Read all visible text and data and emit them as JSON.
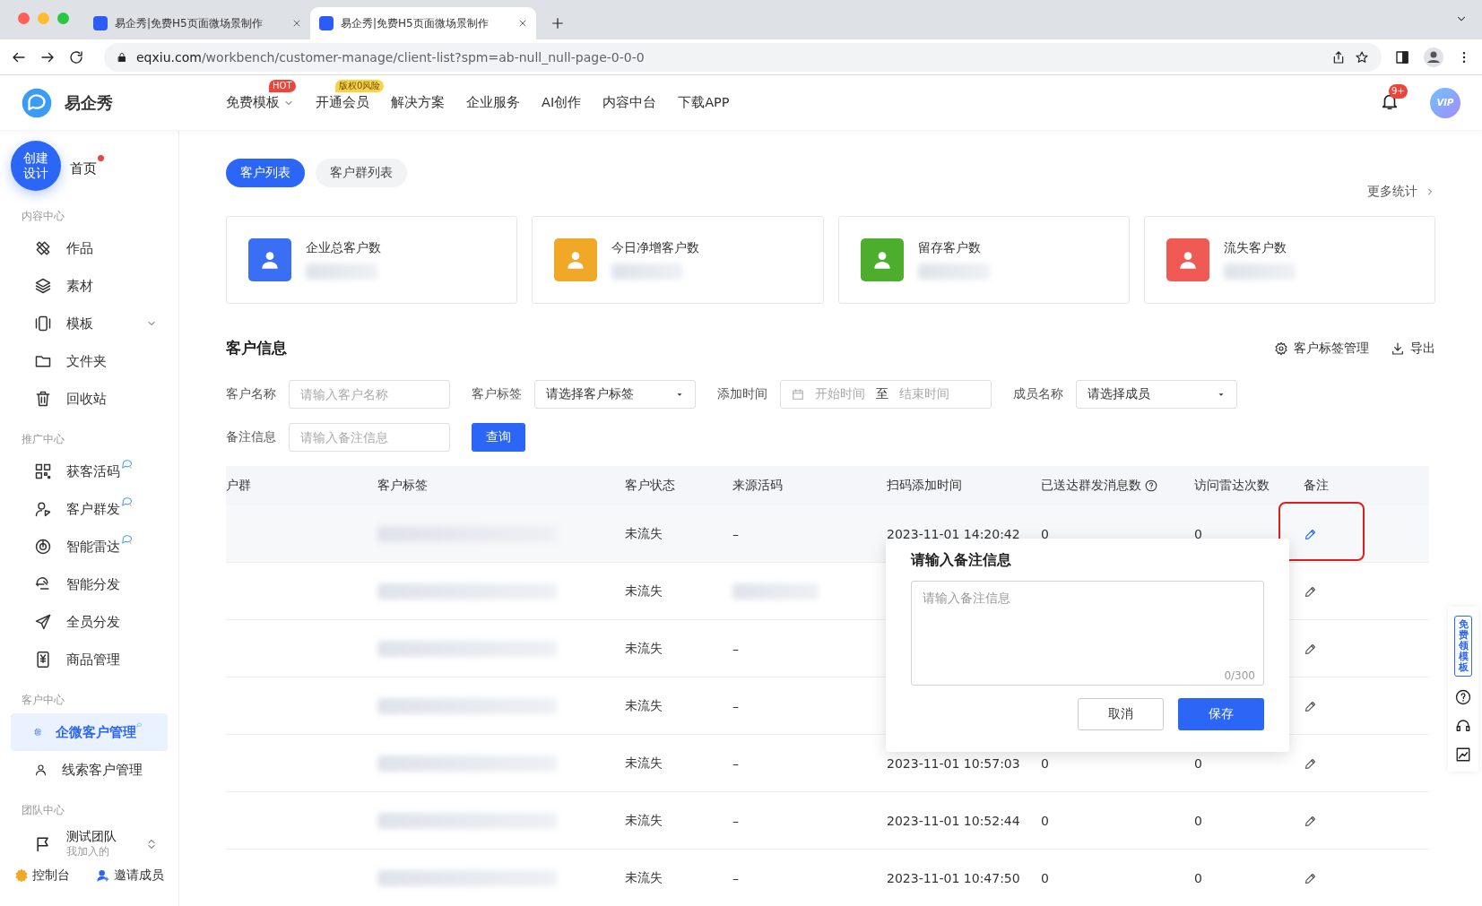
{
  "browser": {
    "tabs": [
      {
        "title": "易企秀|免费H5页面微场景制作",
        "selected": false
      },
      {
        "title": "易企秀|免费H5页面微场景制作",
        "selected": true
      }
    ],
    "url_host": "eqxiu.com",
    "url_path": "/workbench/customer-manage/client-list?spm=ab-null_null-page-0-0-0"
  },
  "header": {
    "logo_text": "易企秀",
    "nav": [
      {
        "label": "免费模板",
        "badge": "HOT",
        "caret": true
      },
      {
        "label": "开通会员",
        "badge": "版权0风险",
        "caret": false
      },
      {
        "label": "解决方案",
        "caret": false
      },
      {
        "label": "企业服务",
        "caret": false
      },
      {
        "label": "AI创作",
        "caret": false
      },
      {
        "label": "内容中台",
        "caret": false
      },
      {
        "label": "下载APP",
        "caret": false
      }
    ],
    "notifications": "9+",
    "vip": "VIP"
  },
  "sidebar": {
    "create_button": [
      "创建",
      "设计"
    ],
    "home": {
      "label": "首页",
      "dot": true
    },
    "sections": [
      {
        "title": "内容中心",
        "items": [
          {
            "label": "作品",
            "selected": false,
            "new": false,
            "expandable": false
          },
          {
            "label": "素材",
            "selected": false,
            "new": false,
            "expandable": false
          },
          {
            "label": "模板",
            "selected": false,
            "new": false,
            "expandable": true
          },
          {
            "label": "文件夹",
            "selected": false,
            "new": false,
            "expandable": false
          },
          {
            "label": "回收站",
            "selected": false,
            "new": false,
            "expandable": false
          }
        ]
      },
      {
        "title": "推广中心",
        "items": [
          {
            "label": "获客活码",
            "selected": false,
            "new": true,
            "expandable": false
          },
          {
            "label": "客户群发",
            "selected": false,
            "new": true,
            "expandable": false
          },
          {
            "label": "智能雷达",
            "selected": false,
            "new": true,
            "expandable": false
          },
          {
            "label": "智能分发",
            "selected": false,
            "new": false,
            "expandable": false
          },
          {
            "label": "全员分发",
            "selected": false,
            "new": false,
            "expandable": false
          },
          {
            "label": "商品管理",
            "selected": false,
            "new": false,
            "expandable": false
          }
        ]
      },
      {
        "title": "客户中心",
        "items": [
          {
            "label": "企微客户管理",
            "selected": true,
            "new": true,
            "expandable": false
          },
          {
            "label": "线索客户管理",
            "selected": false,
            "new": false,
            "expandable": false
          }
        ]
      },
      {
        "title": "团队中心"
      }
    ],
    "team": {
      "name": "测试团队",
      "sub": "我加入的"
    },
    "footer": [
      "控制台",
      "邀请成员"
    ]
  },
  "content": {
    "tabs": [
      {
        "label": "客户列表",
        "selected": true
      },
      {
        "label": "客户群列表",
        "selected": false
      }
    ],
    "more_stats": "更多统计",
    "stat_cards": [
      {
        "label": "企业总客户数",
        "color": "#3a6ff5"
      },
      {
        "label": "今日净增客户数",
        "color": "#f0a826"
      },
      {
        "label": "留存客户数",
        "color": "#4cae2c"
      },
      {
        "label": "流失客户数",
        "color": "#f05a55"
      }
    ],
    "section_title": "客户信息",
    "actions": [
      "客户标签管理",
      "导出"
    ],
    "filters": [
      {
        "kind": "input",
        "label": "客户名称",
        "placeholder": "请输入客户名称"
      },
      {
        "kind": "select",
        "label": "客户标签",
        "value": "请选择客户标签"
      },
      {
        "kind": "daterange",
        "label": "添加时间",
        "start": "开始时间",
        "to": "至",
        "end": "结束时间"
      },
      {
        "kind": "select",
        "label": "成员名称",
        "value": "请选择成员"
      },
      {
        "kind": "input",
        "label": "备注信息",
        "placeholder": "请输入备注信息"
      }
    ],
    "query_button": "查询",
    "table": {
      "columns": [
        {
          "label": "户群",
          "help": false
        },
        {
          "label": "客户标签",
          "help": false
        },
        {
          "label": "客户状态",
          "help": false
        },
        {
          "label": "来源活码",
          "help": false
        },
        {
          "label": "扫码添加时间",
          "help": false
        },
        {
          "label": "已送达群发消息数",
          "help": true
        },
        {
          "label": "访问雷达次数",
          "help": false
        },
        {
          "label": "备注",
          "help": false
        }
      ],
      "rows": [
        {
          "selected": true,
          "tag_blurred": true,
          "status": "未流失",
          "source": "–",
          "time": "2023-11-01 14:20:42",
          "sent": "0",
          "visits": "0"
        },
        {
          "selected": false,
          "tag_blurred": true,
          "status": "未流失",
          "source_blurred": true
        },
        {
          "selected": false,
          "tag_blurred": true,
          "status": "未流失",
          "source": "–"
        },
        {
          "selected": false,
          "tag_blurred": true,
          "status": "未流失",
          "source": "–"
        },
        {
          "selected": false,
          "tag_blurred": true,
          "status": "未流失",
          "source": "–",
          "time": "2023-11-01 10:57:03",
          "sent": "0",
          "visits": "0"
        },
        {
          "selected": false,
          "tag_blurred": true,
          "status": "未流失",
          "source": "–",
          "time": "2023-11-01 10:52:44",
          "sent": "0",
          "visits": "0"
        },
        {
          "selected": false,
          "tag_blurred": true,
          "status": "未流失",
          "source": "–",
          "time": "2023-11-01 10:47:50",
          "sent": "0",
          "visits": "0"
        }
      ]
    },
    "popup": {
      "title": "请输入备注信息",
      "placeholder": "请输入备注信息",
      "counter": "0/300",
      "cancel": "取消",
      "save": "保存"
    },
    "side_widget": {
      "label": "免费领模板"
    }
  }
}
